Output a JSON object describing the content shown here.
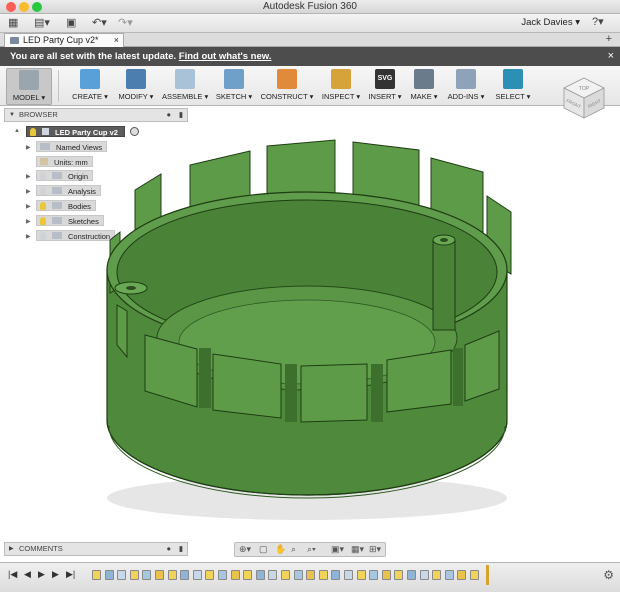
{
  "window": {
    "title": "Autodesk Fusion 360"
  },
  "quick_access": {
    "user": "Jack Davies",
    "help": "?"
  },
  "tab": {
    "label": "LED Party Cup v2*",
    "close": "×"
  },
  "banner": {
    "text": "You are all set with the latest update.",
    "link": "Find out what's new.",
    "close": "×"
  },
  "toolbar": [
    {
      "label": "MODEL ▾",
      "icon": "model-icon",
      "color": "#9aa5ad"
    },
    {
      "label": "CREATE ▾",
      "icon": "box-icon",
      "color": "#5aa0d8"
    },
    {
      "label": "MODIFY ▾",
      "icon": "modify-icon",
      "color": "#4c7fb0"
    },
    {
      "label": "ASSEMBLE ▾",
      "icon": "assemble-icon",
      "color": "#a9c2d8"
    },
    {
      "label": "SKETCH ▾",
      "icon": "sketch-icon",
      "color": "#6fa0c9"
    },
    {
      "label": "CONSTRUCT ▾",
      "icon": "construct-icon",
      "color": "#e08a3a"
    },
    {
      "label": "INSPECT ▾",
      "icon": "inspect-icon",
      "color": "#d6a23a"
    },
    {
      "label": "INSERT ▾",
      "icon": "svg-icon",
      "color": "#333333"
    },
    {
      "label": "MAKE ▾",
      "icon": "make-icon",
      "color": "#6a7b8c"
    },
    {
      "label": "ADD-INS ▾",
      "icon": "addins-icon",
      "color": "#8ea3b8"
    },
    {
      "label": "SELECT ▾",
      "icon": "select-icon",
      "color": "#2d8fb3"
    }
  ],
  "viewcube": {
    "top": "TOP",
    "front": "FRONT",
    "right": "RIGHT"
  },
  "browser": {
    "title": "BROWSER",
    "root": "LED Party Cup v2",
    "items": [
      "Named Views",
      "Units: mm",
      "Origin",
      "Analysis",
      "Bodies",
      "Sketches",
      "Construction"
    ]
  },
  "comments": {
    "title": "COMMENTS"
  },
  "colors": {
    "accent": "#2d8fb3",
    "model_fill": "#4f8a3c",
    "model_edge": "#1d3d12",
    "banner": "#4d4d4d"
  }
}
